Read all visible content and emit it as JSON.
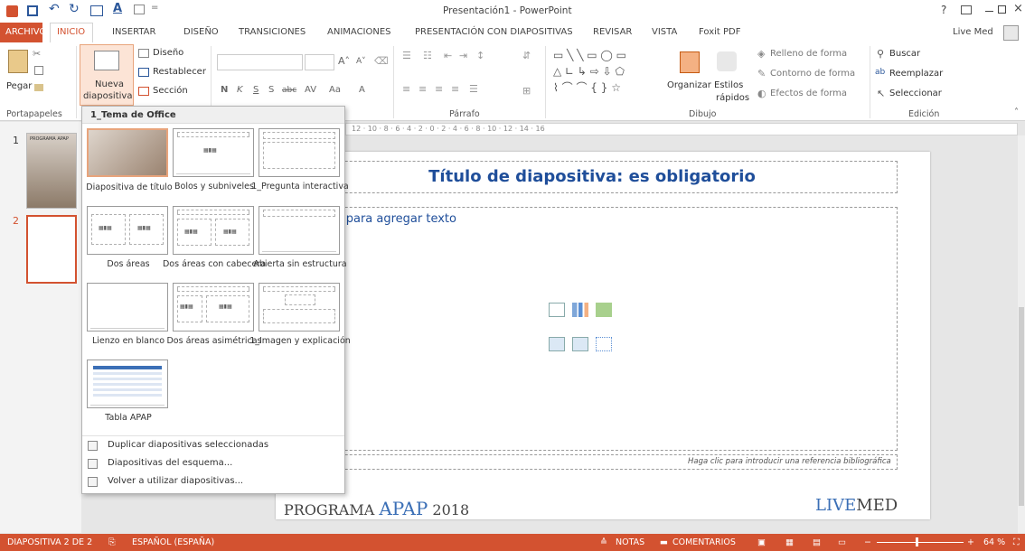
{
  "window": {
    "title": "Presentación1 - PowerPoint",
    "help": "?",
    "user": "Live Med"
  },
  "tabs": [
    "ARCHIVO",
    "INICIO",
    "INSERTAR",
    "DISEÑO",
    "TRANSICIONES",
    "ANIMACIONES",
    "PRESENTACIÓN CON DIAPOSITIVAS",
    "REVISAR",
    "VISTA",
    "Foxit PDF"
  ],
  "ribbon": {
    "paste": "Pegar",
    "new_slide": [
      "Nueva",
      "diapositiva"
    ],
    "layout": "Diseño",
    "reset": "Restablecer",
    "section": "Sección",
    "font_btns": [
      "N",
      "K",
      "S",
      "S",
      "abc",
      "AV",
      "Aa",
      "A"
    ],
    "arrange": "Organizar",
    "quick_styles": [
      "Estilos",
      "rápidos"
    ],
    "shape_fill": "Relleno de forma",
    "shape_outline": "Contorno de forma",
    "shape_effects": "Efectos de forma",
    "find": "Buscar",
    "replace": "Reemplazar",
    "select": "Seleccionar",
    "groups": {
      "clipboard": "Portapapeles",
      "paragraph": "Párrafo",
      "drawing": "Dibujo",
      "editing": "Edición"
    }
  },
  "ruler": "12 · 10 · 8 · 6 · 4 · 2 · 0 · 2 · 4 · 6 · 8 · 10 · 12 · 14 · 16",
  "dropdown": {
    "header": "1_Tema de Office",
    "layouts": [
      "Diapositiva de título",
      "Bolos y subniveles",
      "1_Pregunta interactiva",
      "Dos áreas",
      "Dos áreas con cabecera",
      "Abierta sin estructura",
      "Lienzo en blanco",
      "Dos áreas asimétricas",
      "1_Imagen y explicación",
      "Tabla APAP"
    ],
    "menu": [
      "Duplicar diapositivas seleccionadas",
      "Diapositivas del esquema...",
      "Volver a utilizar diapositivas..."
    ]
  },
  "slides_panel": {
    "numbers": [
      "1",
      "2"
    ],
    "thumb1_text": "PROGRAMA APAP"
  },
  "slide": {
    "title": "Título de diapositiva: es obligatorio",
    "body": "Haga clic para agregar texto",
    "reference": "Haga clic para introducir una referencia bibliográfica",
    "logo_left_a": "PROGRAMA ",
    "logo_left_b": "APAP",
    "logo_left_c": " 2018",
    "logo_right_a": "LIVE",
    "logo_right_b": "MED",
    "accent": "#1f4e9a"
  },
  "status": {
    "slide": "DIAPOSITIVA 2 DE 2",
    "lang": "ESPAÑOL (ESPAÑA)",
    "notes": "NOTAS",
    "comments": "COMENTARIOS",
    "zoom": "64 %",
    "color": "#d35230"
  }
}
